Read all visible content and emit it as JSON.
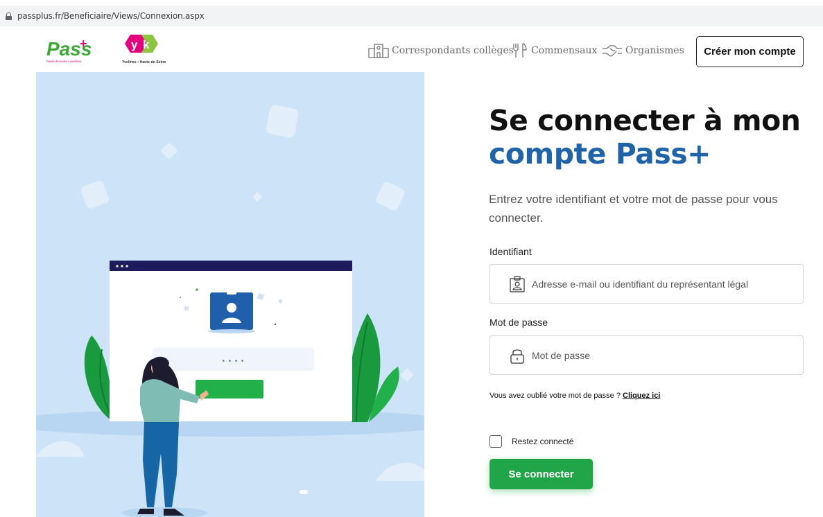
{
  "browser": {
    "url": "passplus.fr/Beneficiaire/Views/Connexion.aspx"
  },
  "header": {
    "logo_pass_text": "Pass",
    "logo_pass_plus": "+",
    "logo_pass_tagline": "hauts-de-seine • yvelines",
    "logo_yk_caption": "Yvelines • Hauts-de-Seine",
    "nav": [
      {
        "label": "Correspondants collèges",
        "icon": "school-building-icon"
      },
      {
        "label": "Commensaux",
        "icon": "cutlery-icon"
      },
      {
        "label": "Organismes",
        "icon": "handshake-icon"
      }
    ],
    "create_account_label": "Créer mon compte"
  },
  "illustration": {
    "password_dots": "• • • •"
  },
  "login": {
    "title_line1": "Se connecter à mon",
    "title_line2": "compte Pass+",
    "subtitle": "Entrez votre identifiant et votre mot de passe pour vous connecter.",
    "identifiant_label": "Identifiant",
    "identifiant_placeholder": "Adresse e-mail ou identifiant du représentant légal",
    "password_label": "Mot de passe",
    "password_placeholder": "Mot de passe",
    "forgot_text": "Vous avez oublié votre mot de passe ?",
    "forgot_link": "Cliquez ici",
    "remember_label": "Restez connecté",
    "submit_label": "Se connecter"
  },
  "colors": {
    "accent_blue": "#1f64a8",
    "button_green": "#20a548",
    "illustration_bg": "#cde3f7"
  }
}
